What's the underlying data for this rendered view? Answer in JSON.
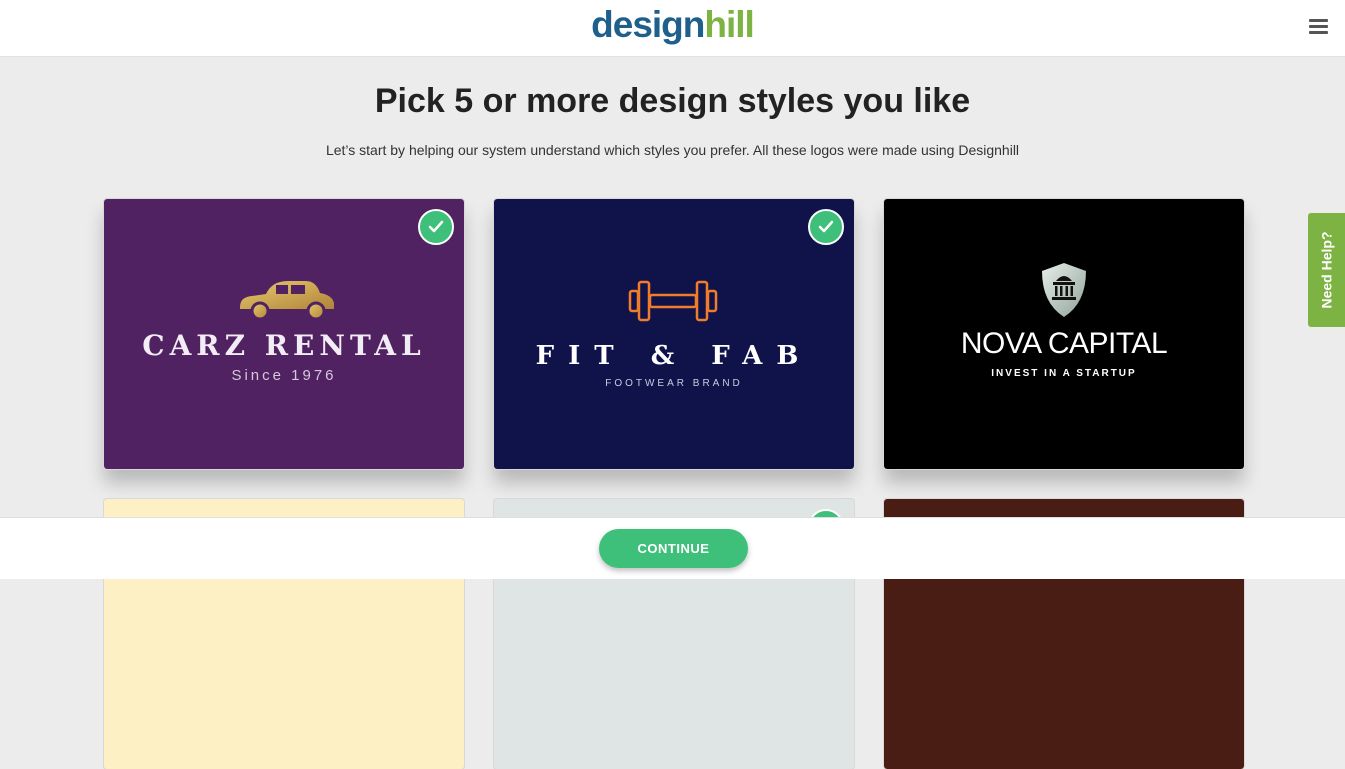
{
  "header": {
    "logo_part1": "design",
    "logo_part2": "hill",
    "menu_icon": "hamburger-menu-icon"
  },
  "main": {
    "title": "Pick 5 or more design styles you like",
    "subtitle": "Let’s start by helping our system understand which styles you prefer. All these logos were made using Designhill"
  },
  "cards": [
    {
      "line1": "CARZ RENTAL",
      "line2": "Since 1976",
      "selected": true,
      "icon": "car-icon",
      "bg": "#512262"
    },
    {
      "line1": "FIT & FAB",
      "line2": "FOOTWEAR BRAND",
      "selected": true,
      "icon": "dumbbell-icon",
      "bg": "#10134a"
    },
    {
      "line1": "NOVA CAPITAL",
      "line2": "INVEST IN A STARTUP",
      "selected": false,
      "icon": "shield-building-icon",
      "bg": "#000000"
    },
    {
      "selected": false,
      "bg": "#fdf0c4"
    },
    {
      "selected": true,
      "bg": "#dfe4e4"
    },
    {
      "selected": false,
      "bg": "#4a1d14"
    }
  ],
  "help_tab": {
    "label": "Need Help?"
  },
  "footer": {
    "continue_label": "CONTINUE"
  },
  "colors": {
    "accent_green": "#3ec07b",
    "brand_blue": "#1f5f8b",
    "brand_green": "#7cb342"
  }
}
